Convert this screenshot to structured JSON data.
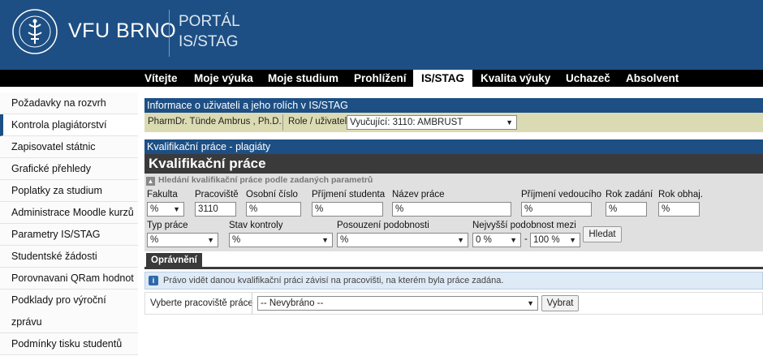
{
  "header": {
    "brand": "VFU BRNO",
    "portal_line1": "PORTÁL",
    "portal_line2": "IS/STAG",
    "logo_icon": "university-seal-icon"
  },
  "nav": {
    "items": [
      "Vítejte",
      "Moje výuka",
      "Moje studium",
      "Prohlížení",
      "IS/STAG",
      "Kvalita výuky",
      "Uchazeč",
      "Absolvent"
    ],
    "active": "IS/STAG"
  },
  "sidebar": {
    "items": [
      "Požadavky na rozvrh",
      "Kontrola plagiátorství",
      "Zapisovatel státnic",
      "Grafické přehledy",
      "Poplatky za studium",
      "Administrace Moodle kurzů",
      "Parametry IS/STAG",
      "Studentské žádosti",
      "Porovnavani QRam hodnot",
      "Podklady pro výroční zprávu",
      "Podmínky tisku studentů"
    ],
    "active": "Kontrola plagiátorství"
  },
  "userinfo": {
    "title": "Informace o uživateli a jeho rolích v IS/STAG",
    "name": "PharmDr. Tünde Ambrus , Ph.D.,",
    "role_label": "Role / uživatel",
    "role_value": "Vyučující: 3110: AMBRUST"
  },
  "section": {
    "bar_title": "Kvalifikační práce - plagiáty",
    "big_title": "Kvalifikační práce",
    "search_header": "Hledání kvalifikační práce podle zadaných parametrů"
  },
  "form": {
    "fakulta": {
      "label": "Fakulta",
      "value": "%"
    },
    "pracoviste": {
      "label": "Pracoviště",
      "value": "3110"
    },
    "osobni_cislo": {
      "label": "Osobní číslo",
      "value": "%"
    },
    "prijmeni_studenta": {
      "label": "Příjmení studenta",
      "value": "%"
    },
    "nazev_prace": {
      "label": "Název práce",
      "value": "%"
    },
    "prijmeni_vedouciho": {
      "label": "Příjmení vedoucího",
      "value": "%"
    },
    "rok_zadani": {
      "label": "Rok zadání",
      "value": "%"
    },
    "rok_obhaj": {
      "label": "Rok obhaj.",
      "value": "%"
    },
    "typ_prace": {
      "label": "Typ práce",
      "value": "%"
    },
    "stav_kontroly": {
      "label": "Stav kontroly",
      "value": "%"
    },
    "posouzeni": {
      "label": "Posouzení podobnosti",
      "value": "%"
    },
    "podobnost": {
      "label": "Nejvyšší podobnost mezi",
      "from": "0 %",
      "dash": "-",
      "to": "100 %"
    },
    "search_button": "Hledat"
  },
  "permissions": {
    "tab": "Oprávnění",
    "info": "Právo vidět danou kvalifikační práci závisí na pracovišti, na kterém byla práce zadána.",
    "workplace_label": "Vyberte pracoviště práce",
    "workplace_value": "-- Nevybráno --",
    "choose_button": "Vybrat"
  }
}
